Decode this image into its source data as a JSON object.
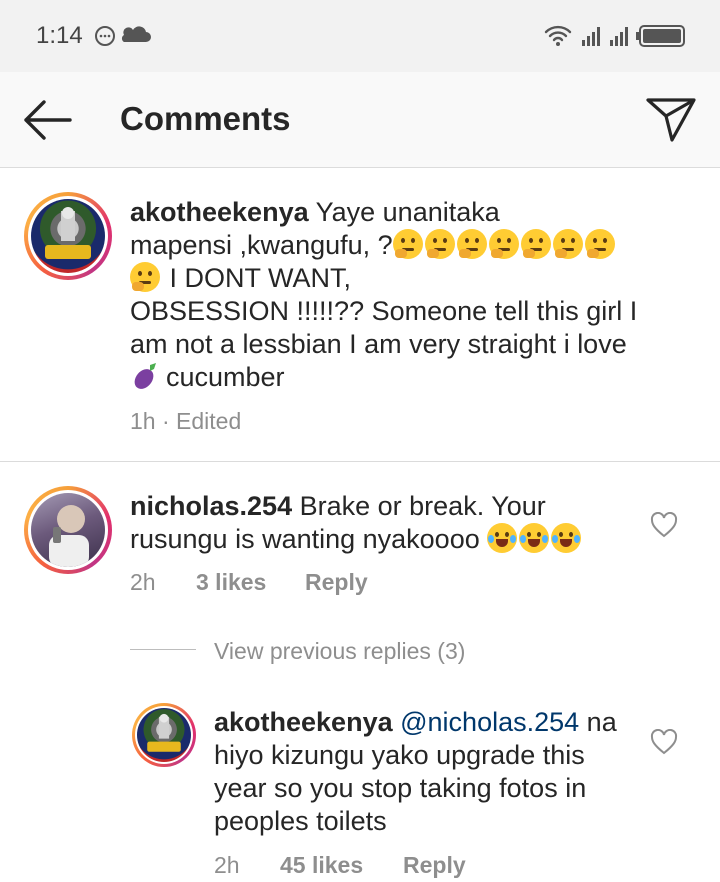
{
  "status_bar": {
    "time": "1:14"
  },
  "header": {
    "title": "Comments"
  },
  "comments": [
    {
      "username": "akotheekenya",
      "lines": [
        "Yaye unanitaka",
        "mapensi ,kwangufu, ?",
        "I DONT WANT,",
        "OBSESSION !!!!!?? Someone tell this girl I",
        "am not a lessbian I am very straight i love",
        "cucumber"
      ],
      "time": "1h",
      "separator": "·",
      "edited": "Edited",
      "emoji_thinking_count": 8
    },
    {
      "username": "nicholas.254",
      "lines": [
        "Brake or break. Your",
        "rusungu is wanting nyakoooo"
      ],
      "time": "2h",
      "likes": "3 likes",
      "reply": "Reply"
    }
  ],
  "view_replies": "View previous replies (3)",
  "reply": {
    "username": "akotheekenya",
    "mention": "@nicholas.254",
    "lines": [
      "na",
      "hiyo kizungu yako upgrade this",
      "year so you stop taking fotos in",
      "peoples toilets"
    ],
    "time": "2h",
    "likes": "45 likes",
    "reply": "Reply"
  },
  "icons": {
    "back": "arrow-left-icon",
    "send": "paper-plane-icon",
    "heart": "heart-outline-icon",
    "wifi": "wifi-icon",
    "signal": "signal-icon",
    "battery": "battery-icon"
  }
}
